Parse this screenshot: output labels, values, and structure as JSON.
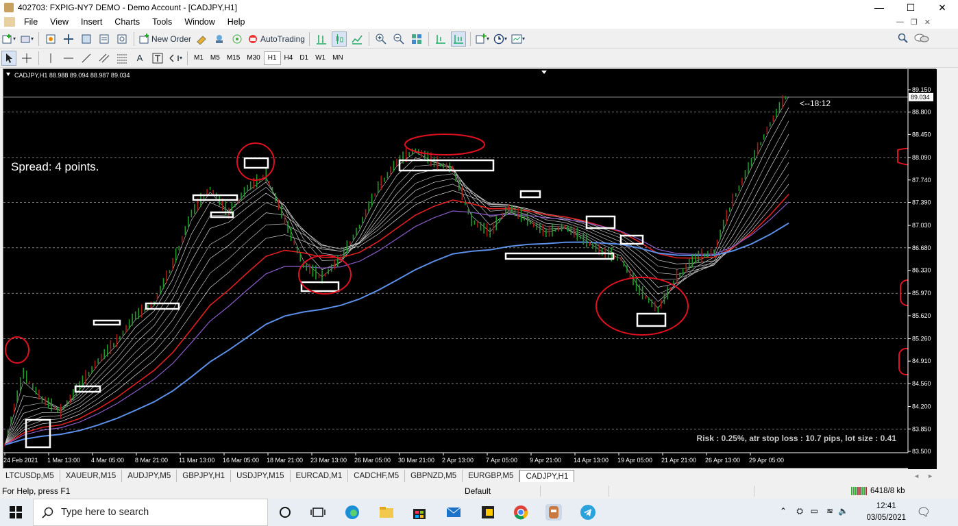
{
  "window": {
    "title": "402703: FXPIG-NY7 DEMO - Demo Account - [CADJPY,H1]",
    "controls": [
      "—",
      "☐",
      "✕"
    ]
  },
  "menu": {
    "items": [
      "File",
      "View",
      "Insert",
      "Charts",
      "Tools",
      "Window",
      "Help"
    ]
  },
  "toolbar": {
    "new_order_label": "New Order",
    "autotrading_label": "AutoTrading"
  },
  "timeframes": [
    "M1",
    "M5",
    "M15",
    "M30",
    "H1",
    "H4",
    "D1",
    "W1",
    "MN"
  ],
  "active_timeframe": "H1",
  "chart": {
    "header": "CADJPY,H1  88.988 89.094 88.987 89.034",
    "spread_text": "Spread: 4 points.",
    "countdown": "<--18:12",
    "risk_text": "Risk : 0.25%, atr stop loss : 10.7 pips, lot size : 0.41",
    "current_price": "89.034",
    "price_ticks": [
      "89.150",
      "88.800",
      "88.450",
      "88.090",
      "87.740",
      "87.390",
      "87.030",
      "86.680",
      "86.330",
      "85.970",
      "85.620",
      "85.260",
      "84.910",
      "84.560",
      "84.200",
      "83.850",
      "83.500"
    ],
    "date_ticks": [
      "24 Feb 2021",
      "1 Mar 13:00",
      "4 Mar 05:00",
      "8 Mar 21:00",
      "11 Mar 13:00",
      "16 Mar 05:00",
      "18 Mar 21:00",
      "23 Mar 13:00",
      "26 Mar 05:00",
      "30 Mar 21:00",
      "2 Apr 13:00",
      "7 Apr 05:00",
      "9 Apr 21:00",
      "14 Apr 13:00",
      "19 Apr 05:00",
      "21 Apr 21:00",
      "26 Apr 13:00",
      "29 Apr 05:00"
    ],
    "colors": {
      "background": "#000000",
      "grid": "#c8c8c8",
      "ema_slow": "#5b8fe8",
      "ema_red": "#e02020",
      "annotation": "#e01020",
      "box": "#ffffff"
    }
  },
  "chart_data": {
    "type": "line",
    "series": [
      {
        "values": [
          83.6,
          84.7,
          84.3,
          84.1,
          84.5,
          84.9,
          85.2,
          85.6,
          85.8,
          86.4,
          87.2,
          87.6,
          87.2,
          87.6,
          87.8,
          87.1,
          86.4,
          86.2,
          86.5,
          87.0,
          87.6,
          88.0,
          88.2,
          88.0,
          87.9,
          87.1,
          86.9,
          87.3,
          87.1,
          86.9,
          87.0,
          86.8,
          86.6,
          86.5,
          86.0,
          85.7,
          86.2,
          86.5,
          86.6,
          87.4,
          88.0,
          88.6,
          89.1
        ]
      }
    ]
  },
  "tabs": [
    "LTCUSDp,M5",
    "XAUEUR,M15",
    "AUDJPY,M5",
    "GBPJPY,H1",
    "USDJPY,M15",
    "EURCAD,M1",
    "CADCHF,M5",
    "GBPNZD,M5",
    "EURGBP,M5",
    "CADJPY,H1"
  ],
  "active_tab": "CADJPY,H1",
  "status": {
    "help": "For Help, press F1",
    "profile": "Default",
    "traffic": "6418/8 kb"
  },
  "taskbar": {
    "search_placeholder": "Type here to search",
    "time": "12:41",
    "date": "03/05/2021"
  }
}
